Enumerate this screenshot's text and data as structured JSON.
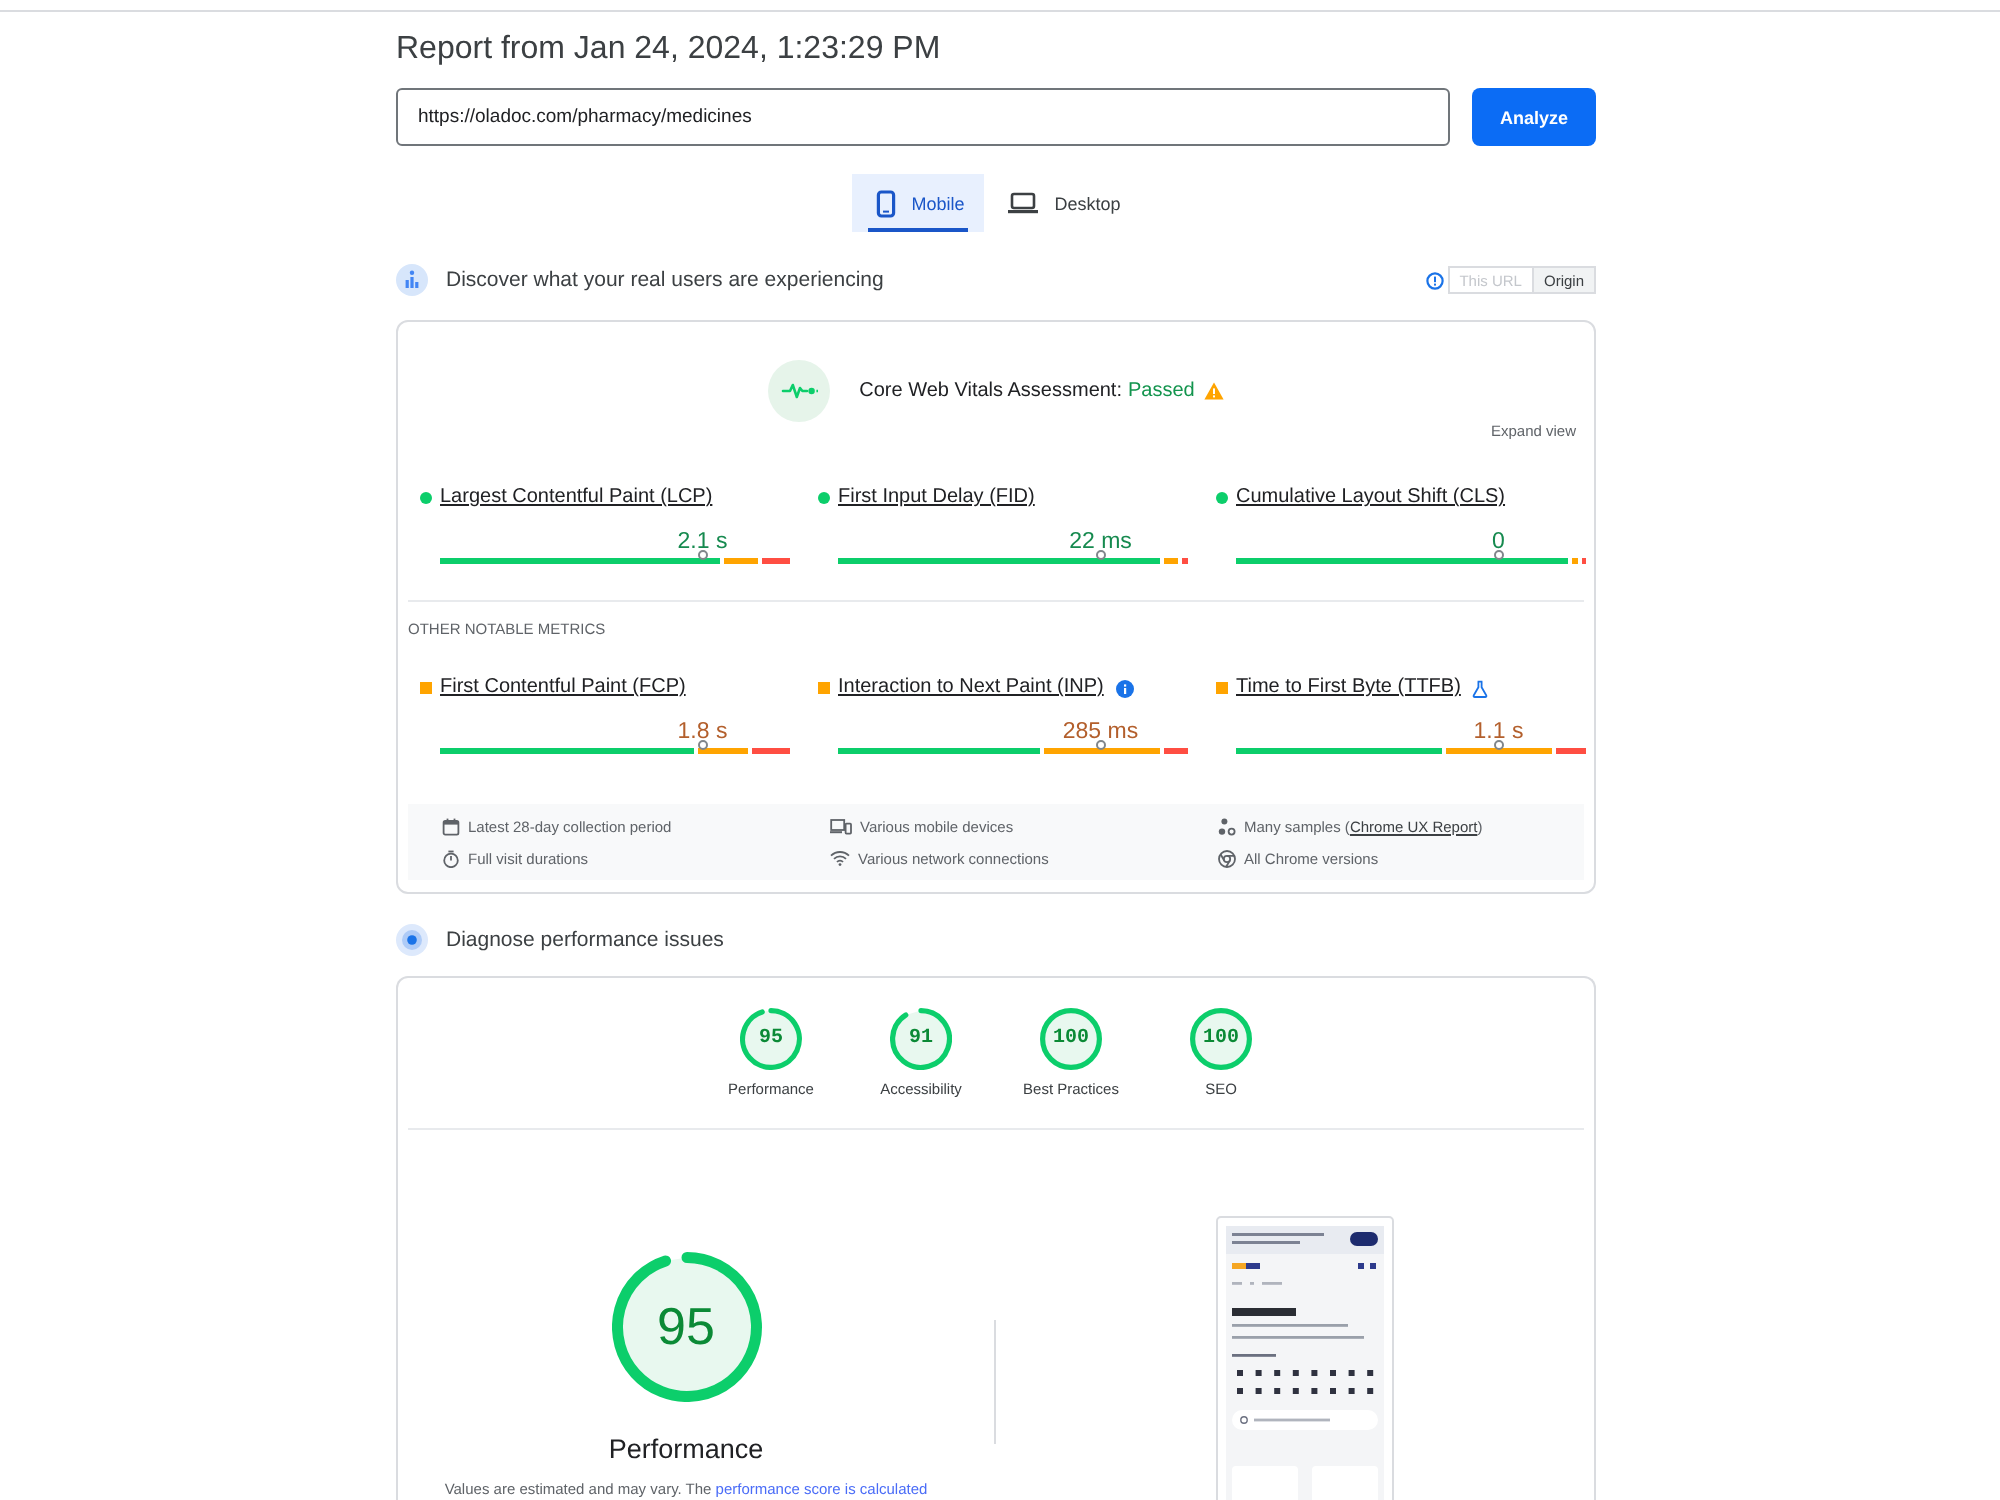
{
  "report": {
    "title": "Report from Jan 24, 2024, 1:23:29 PM",
    "url_field": {
      "value": "https://oladoc.com/pharmacy/medicines"
    },
    "analyze_button": "Analyze"
  },
  "device_tabs": [
    {
      "label": "Mobile",
      "selected": true
    },
    {
      "label": "Desktop",
      "selected": false
    }
  ],
  "field_data": {
    "heading": "Discover what your real users are experiencing",
    "scope_toggle": [
      {
        "label": "This URL",
        "selected": false
      },
      {
        "label": "Origin",
        "selected": true
      }
    ],
    "assessment": {
      "label": "Core Web Vitals Assessment:",
      "result": "Passed",
      "passed": true,
      "warning": true
    },
    "expand_link": "Expand view",
    "core_metrics": [
      {
        "name": "Largest Contentful Paint (LCP)",
        "kind": "good",
        "value": "2.1 s",
        "level": 0.75
      },
      {
        "name": "First Input Delay (FID)",
        "kind": "good",
        "value": "22 ms",
        "level": 0.75
      },
      {
        "name": "Cumulative Layout Shift (CLS)",
        "kind": "good",
        "value": "0",
        "level": 0.75
      }
    ],
    "other_heading": "OTHER NOTABLE METRICS",
    "other_metrics": [
      {
        "name": "First Contentful Paint (FCP)",
        "kind": "average",
        "value": "1.8 s",
        "level": 0.75
      },
      {
        "name": "Interaction to Next Paint (INP)",
        "kind": "average",
        "value": "285 ms",
        "level": 0.75,
        "info": true
      },
      {
        "name": "Time to First Byte (TTFB)",
        "kind": "average",
        "value": "1.1 s",
        "level": 0.75,
        "experimental": true
      }
    ],
    "facts": [
      {
        "text": "Latest 28-day collection period"
      },
      {
        "text": "Various mobile devices"
      },
      {
        "text": "Many samples (",
        "link": "Chrome UX Report",
        "after": ")"
      },
      {
        "text": "Full visit durations"
      },
      {
        "text": "Various network connections"
      },
      {
        "text": "All Chrome versions"
      }
    ]
  },
  "lab_data": {
    "heading": "Diagnose performance issues",
    "scores": [
      {
        "score": "95",
        "label": "Performance",
        "level": 0.95
      },
      {
        "score": "91",
        "label": "Accessibility",
        "level": 0.91
      },
      {
        "score": "100",
        "label": "Best Practices",
        "level": 1
      },
      {
        "score": "100",
        "label": "SEO",
        "level": 1
      }
    ],
    "main_score": {
      "score": "95",
      "label": "Performance",
      "level": 0.95
    },
    "note": {
      "text": "Values are estimated and may vary. The ",
      "link": "performance score is calculated"
    }
  }
}
